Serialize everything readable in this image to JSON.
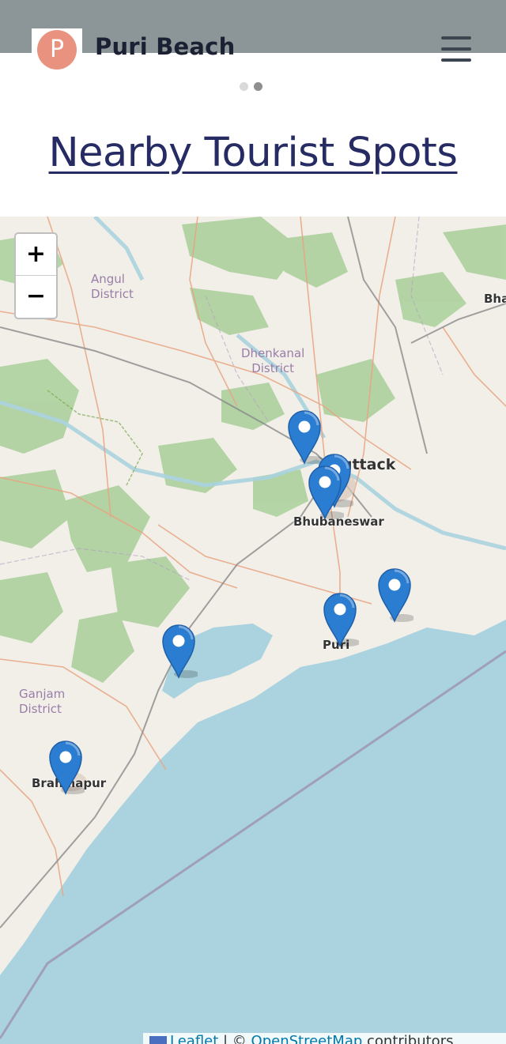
{
  "header": {
    "logo_letter": "P",
    "brand": "Puri Beach",
    "menu_icon": "hamburger-menu-icon"
  },
  "carousel": {
    "dot_count": 2,
    "active_dot": 2
  },
  "page_title": "Nearby Tourist Spots",
  "map": {
    "zoom_in_label": "+",
    "zoom_out_label": "−",
    "labels": {
      "angul": "Angul",
      "angul_district": "District",
      "dhenkanal": "Dhenkanal",
      "dhenkanal_district": "District",
      "ganjam": "Ganjam",
      "ganjam_district": "District",
      "cuttack": "Cuttack",
      "bhubaneswar": "Bhubaneswar",
      "puri": "Puri",
      "brahmapur": "Brahmapur",
      "bha": "Bha"
    },
    "marker_count": 7,
    "marker_icon": "map-pin-icon",
    "colors": {
      "sea": "#aad3df",
      "land": "#f2efe9",
      "forest": "#add19e",
      "marker": "#2a7dd1"
    }
  },
  "attribution": {
    "leaflet": "Leaflet",
    "separator": " | © ",
    "osm": "OpenStreetMap",
    "suffix": " contributors"
  }
}
